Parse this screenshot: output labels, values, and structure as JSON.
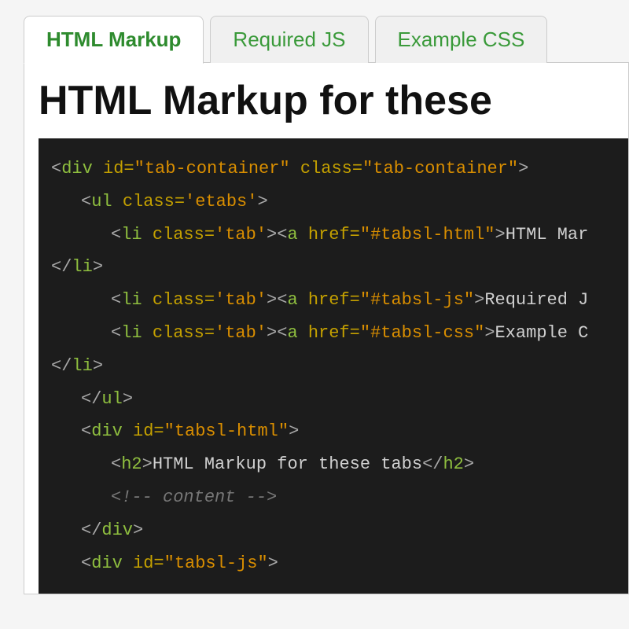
{
  "tabs": {
    "items": [
      {
        "label": "HTML Markup",
        "active": true
      },
      {
        "label": "Required JS",
        "active": false
      },
      {
        "label": "Example CSS",
        "active": false
      }
    ]
  },
  "panel": {
    "heading": "HTML Markup for these"
  },
  "code": {
    "lines": [
      {
        "indent": 0,
        "tokens": [
          {
            "t": "p",
            "v": "<"
          },
          {
            "t": "tg",
            "v": "div"
          },
          {
            "t": "p",
            "v": " "
          },
          {
            "t": "at",
            "v": "id"
          },
          {
            "t": "eq",
            "v": "="
          },
          {
            "t": "st",
            "v": "\"tab-container\""
          },
          {
            "t": "p",
            "v": " "
          },
          {
            "t": "at",
            "v": "class"
          },
          {
            "t": "eq",
            "v": "="
          },
          {
            "t": "st",
            "v": "\"tab-container\""
          },
          {
            "t": "p",
            "v": ">"
          }
        ]
      },
      {
        "indent": 1,
        "tokens": [
          {
            "t": "p",
            "v": "<"
          },
          {
            "t": "tg",
            "v": "ul"
          },
          {
            "t": "p",
            "v": " "
          },
          {
            "t": "at",
            "v": "class"
          },
          {
            "t": "eq",
            "v": "="
          },
          {
            "t": "st",
            "v": "'etabs'"
          },
          {
            "t": "p",
            "v": ">"
          }
        ]
      },
      {
        "indent": 2,
        "tokens": [
          {
            "t": "p",
            "v": "<"
          },
          {
            "t": "tg",
            "v": "li"
          },
          {
            "t": "p",
            "v": " "
          },
          {
            "t": "at",
            "v": "class"
          },
          {
            "t": "eq",
            "v": "="
          },
          {
            "t": "st",
            "v": "'tab'"
          },
          {
            "t": "p",
            "v": "><"
          },
          {
            "t": "tg",
            "v": "a"
          },
          {
            "t": "p",
            "v": " "
          },
          {
            "t": "at",
            "v": "href"
          },
          {
            "t": "eq",
            "v": "="
          },
          {
            "t": "st",
            "v": "\"#tabsl-html\""
          },
          {
            "t": "p",
            "v": ">"
          },
          {
            "t": "tx",
            "v": "HTML Mar"
          }
        ]
      },
      {
        "indent": 0,
        "tokens": [
          {
            "t": "p",
            "v": "</"
          },
          {
            "t": "tg",
            "v": "li"
          },
          {
            "t": "p",
            "v": ">"
          }
        ]
      },
      {
        "indent": 2,
        "tokens": [
          {
            "t": "p",
            "v": "<"
          },
          {
            "t": "tg",
            "v": "li"
          },
          {
            "t": "p",
            "v": " "
          },
          {
            "t": "at",
            "v": "class"
          },
          {
            "t": "eq",
            "v": "="
          },
          {
            "t": "st",
            "v": "'tab'"
          },
          {
            "t": "p",
            "v": "><"
          },
          {
            "t": "tg",
            "v": "a"
          },
          {
            "t": "p",
            "v": " "
          },
          {
            "t": "at",
            "v": "href"
          },
          {
            "t": "eq",
            "v": "="
          },
          {
            "t": "st",
            "v": "\"#tabsl-js\""
          },
          {
            "t": "p",
            "v": ">"
          },
          {
            "t": "tx",
            "v": "Required J"
          }
        ]
      },
      {
        "indent": 2,
        "tokens": [
          {
            "t": "p",
            "v": "<"
          },
          {
            "t": "tg",
            "v": "li"
          },
          {
            "t": "p",
            "v": " "
          },
          {
            "t": "at",
            "v": "class"
          },
          {
            "t": "eq",
            "v": "="
          },
          {
            "t": "st",
            "v": "'tab'"
          },
          {
            "t": "p",
            "v": "><"
          },
          {
            "t": "tg",
            "v": "a"
          },
          {
            "t": "p",
            "v": " "
          },
          {
            "t": "at",
            "v": "href"
          },
          {
            "t": "eq",
            "v": "="
          },
          {
            "t": "st",
            "v": "\"#tabsl-css\""
          },
          {
            "t": "p",
            "v": ">"
          },
          {
            "t": "tx",
            "v": "Example C"
          }
        ]
      },
      {
        "indent": 0,
        "tokens": [
          {
            "t": "p",
            "v": "</"
          },
          {
            "t": "tg",
            "v": "li"
          },
          {
            "t": "p",
            "v": ">"
          }
        ]
      },
      {
        "indent": 1,
        "tokens": [
          {
            "t": "p",
            "v": "</"
          },
          {
            "t": "tg",
            "v": "ul"
          },
          {
            "t": "p",
            "v": ">"
          }
        ]
      },
      {
        "indent": 1,
        "tokens": [
          {
            "t": "p",
            "v": "<"
          },
          {
            "t": "tg",
            "v": "div"
          },
          {
            "t": "p",
            "v": " "
          },
          {
            "t": "at",
            "v": "id"
          },
          {
            "t": "eq",
            "v": "="
          },
          {
            "t": "st",
            "v": "\"tabsl-html\""
          },
          {
            "t": "p",
            "v": ">"
          }
        ]
      },
      {
        "indent": 2,
        "tokens": [
          {
            "t": "p",
            "v": "<"
          },
          {
            "t": "tg",
            "v": "h2"
          },
          {
            "t": "p",
            "v": ">"
          },
          {
            "t": "tx",
            "v": "HTML Markup for these tabs"
          },
          {
            "t": "p",
            "v": "</"
          },
          {
            "t": "tg",
            "v": "h2"
          },
          {
            "t": "p",
            "v": ">"
          }
        ]
      },
      {
        "indent": 2,
        "tokens": [
          {
            "t": "cm",
            "v": "<!-- content -->"
          }
        ]
      },
      {
        "indent": 1,
        "tokens": [
          {
            "t": "p",
            "v": "</"
          },
          {
            "t": "tg",
            "v": "div"
          },
          {
            "t": "p",
            "v": ">"
          }
        ]
      },
      {
        "indent": 1,
        "tokens": [
          {
            "t": "p",
            "v": "<"
          },
          {
            "t": "tg",
            "v": "div"
          },
          {
            "t": "p",
            "v": " "
          },
          {
            "t": "at",
            "v": "id"
          },
          {
            "t": "eq",
            "v": "="
          },
          {
            "t": "st",
            "v": "\"tabsl-js\""
          },
          {
            "t": "p",
            "v": ">"
          }
        ]
      }
    ]
  }
}
